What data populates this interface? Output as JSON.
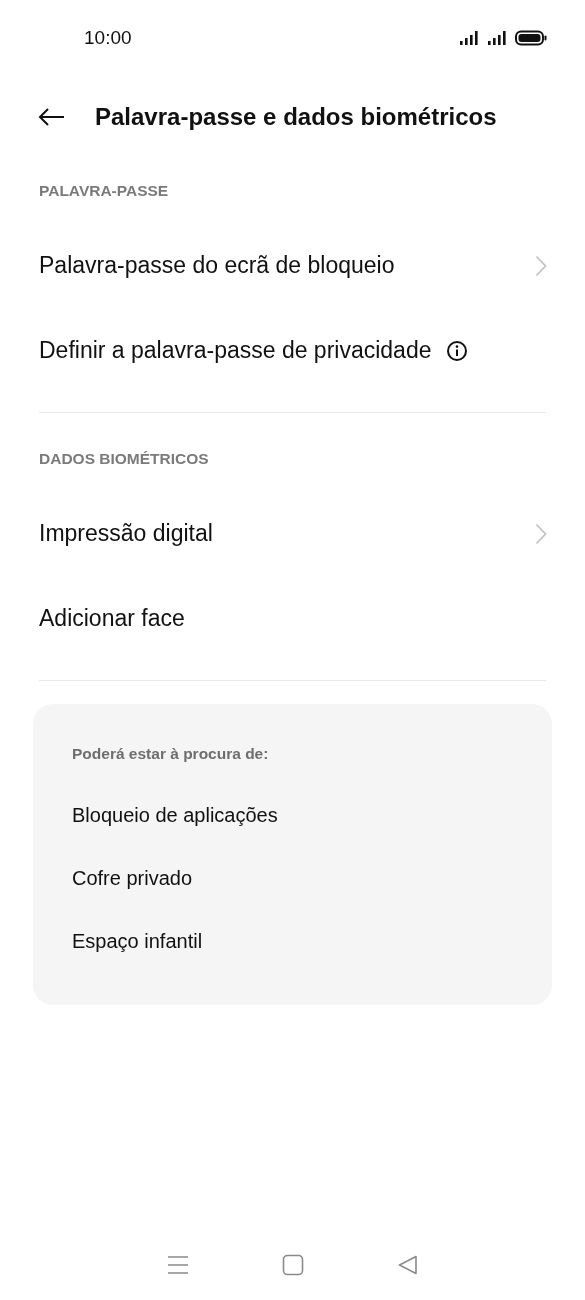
{
  "status_bar": {
    "time": "10:00"
  },
  "header": {
    "title": "Palavra-passe e dados biométricos"
  },
  "sections": [
    {
      "title": "PALAVRA-PASSE",
      "items": [
        {
          "label": "Palavra-passe do ecrã de bloqueio",
          "kind": "link"
        },
        {
          "label": "Definir a palavra-passe de privacidade",
          "kind": "info"
        }
      ]
    },
    {
      "title": "DADOS BIOMÉTRICOS",
      "items": [
        {
          "label": "Impressão digital",
          "kind": "link"
        },
        {
          "label": "Adicionar face",
          "kind": "plain"
        }
      ]
    }
  ],
  "suggestions": {
    "heading": "Poderá estar à procura de:",
    "items": [
      "Bloqueio de aplicações",
      "Cofre privado",
      "Espaço infantil"
    ]
  }
}
